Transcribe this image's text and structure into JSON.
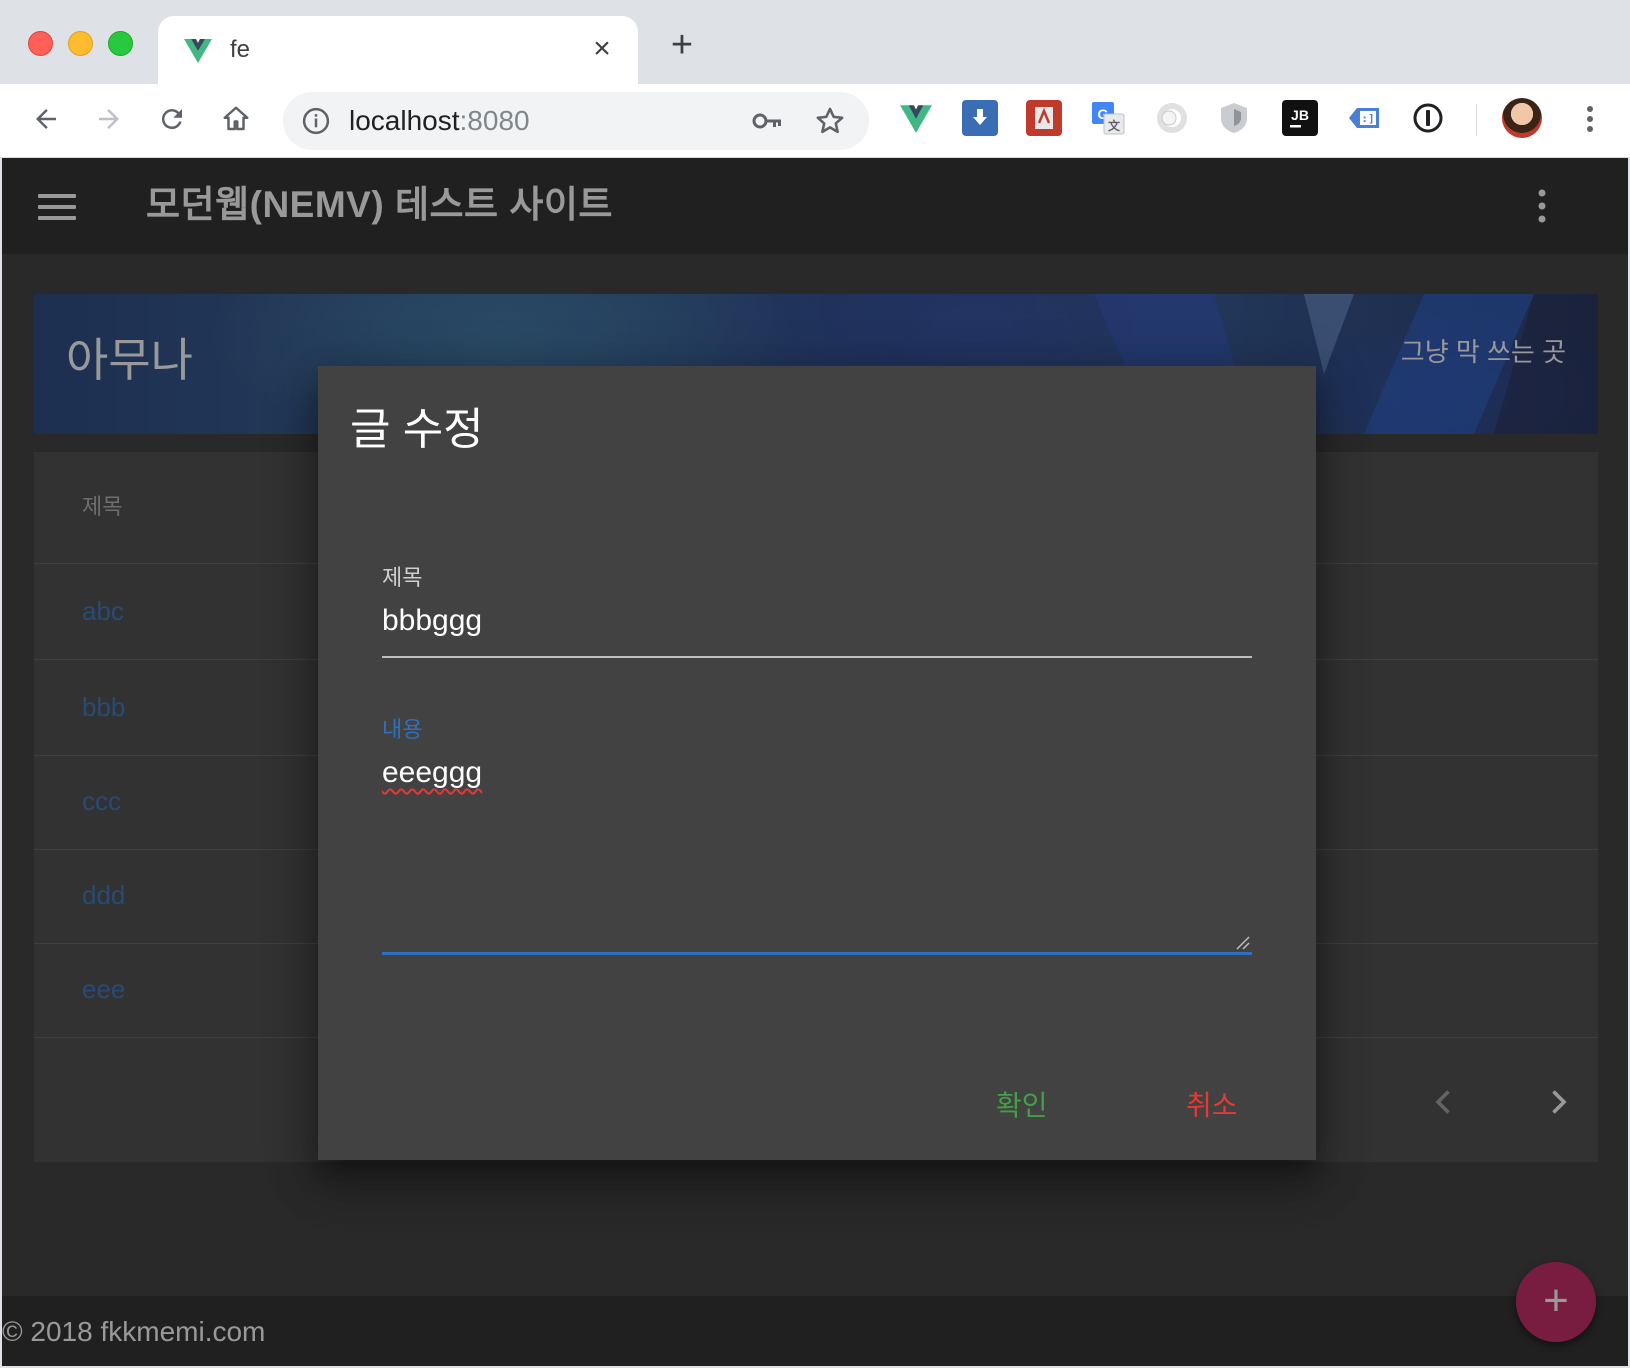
{
  "browser": {
    "tab_title": "fe",
    "url_host": "localhost",
    "url_port": ":8080"
  },
  "app": {
    "title": "모던웹(NEMV) 테스트 사이트"
  },
  "hero": {
    "title": "아무나",
    "subtitle": "그냥 막 쓰는 곳"
  },
  "table": {
    "header": "제목",
    "rows": [
      "abc",
      "bbb",
      "ccc",
      "ddd",
      "eee"
    ]
  },
  "dialog": {
    "title": "글 수정",
    "title_field": {
      "label": "제목",
      "value": "bbbggg"
    },
    "content_field": {
      "label": "내용",
      "value": "eeeggg"
    },
    "confirm_label": "확인",
    "cancel_label": "취소"
  },
  "footer": {
    "text": "© 2018 fkkmemi.com"
  },
  "fab": {
    "label": "+"
  },
  "colors": {
    "accent_blue": "#2f6fbf",
    "confirm_green": "#43a047",
    "cancel_red": "#e53935",
    "fab_pink": "#c2185b"
  },
  "icons": {
    "browser": [
      "back-arrow-icon",
      "forward-arrow-icon",
      "reload-icon",
      "home-icon",
      "info-icon",
      "key-icon",
      "star-icon",
      "kebab-menu-icon"
    ],
    "extensions": [
      "vue-devtools-icon",
      "download-icon",
      "pdf-icon",
      "translate-icon",
      "circle-extension-icon",
      "shield-icon",
      "jetbrains-icon",
      "code-extension-icon",
      "onepassword-icon"
    ],
    "app": [
      "hamburger-menu-icon",
      "more-vert-icon",
      "chevron-left-icon",
      "chevron-right-icon",
      "plus-icon"
    ]
  }
}
